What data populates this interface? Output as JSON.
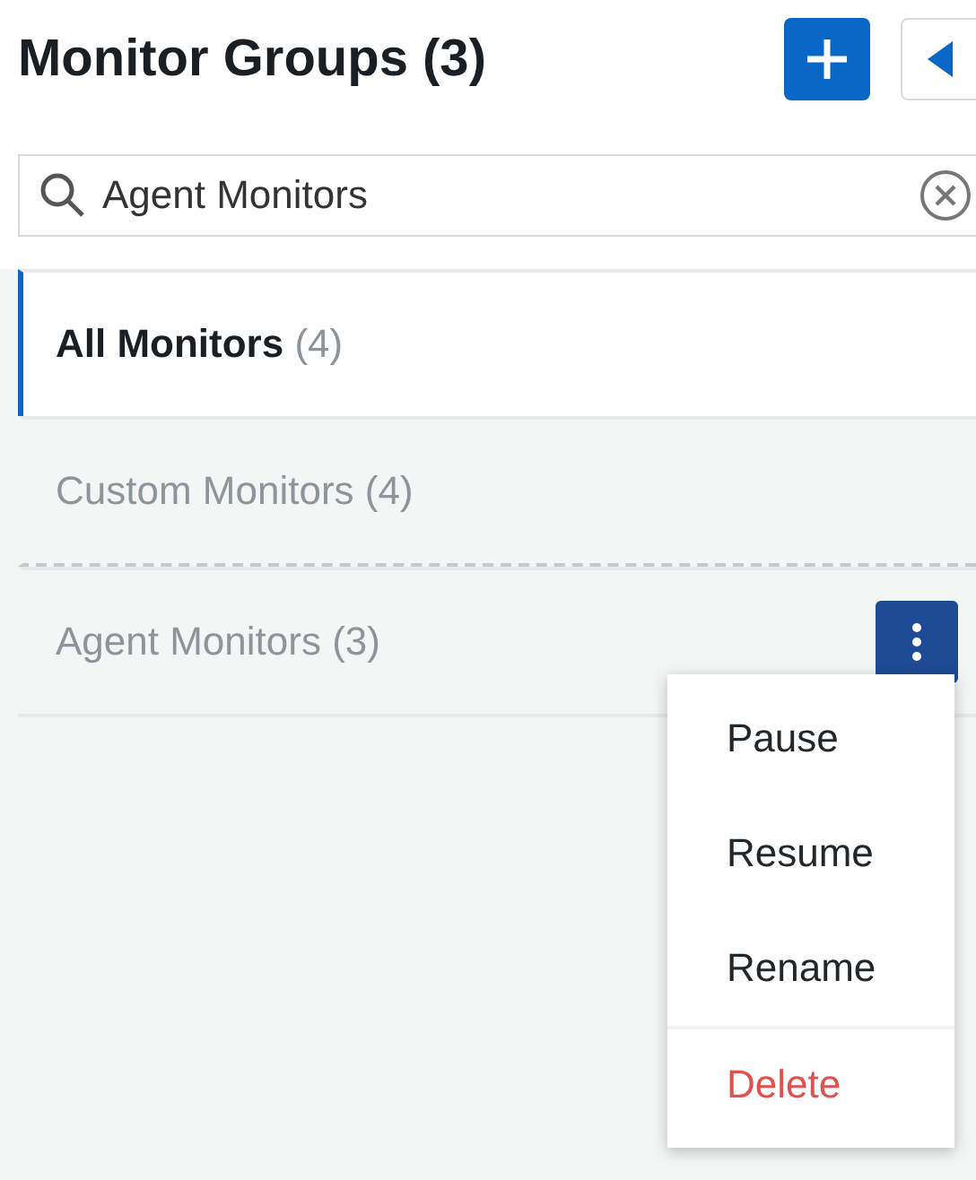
{
  "header": {
    "title": "Monitor Groups (3)"
  },
  "search": {
    "value": "Agent Monitors"
  },
  "groups": [
    {
      "name": "All Monitors",
      "count": "(4)",
      "selected": true,
      "menu_open": false
    },
    {
      "name": "Custom Monitors (4)",
      "selected": false,
      "menu_open": false
    },
    {
      "name": "Agent Monitors (3)",
      "selected": false,
      "menu_open": true
    }
  ],
  "menu": [
    {
      "label": "Pause",
      "kind": "action"
    },
    {
      "label": "Resume",
      "kind": "action"
    },
    {
      "label": "Rename",
      "kind": "action"
    },
    {
      "label": "Delete",
      "kind": "danger"
    }
  ]
}
